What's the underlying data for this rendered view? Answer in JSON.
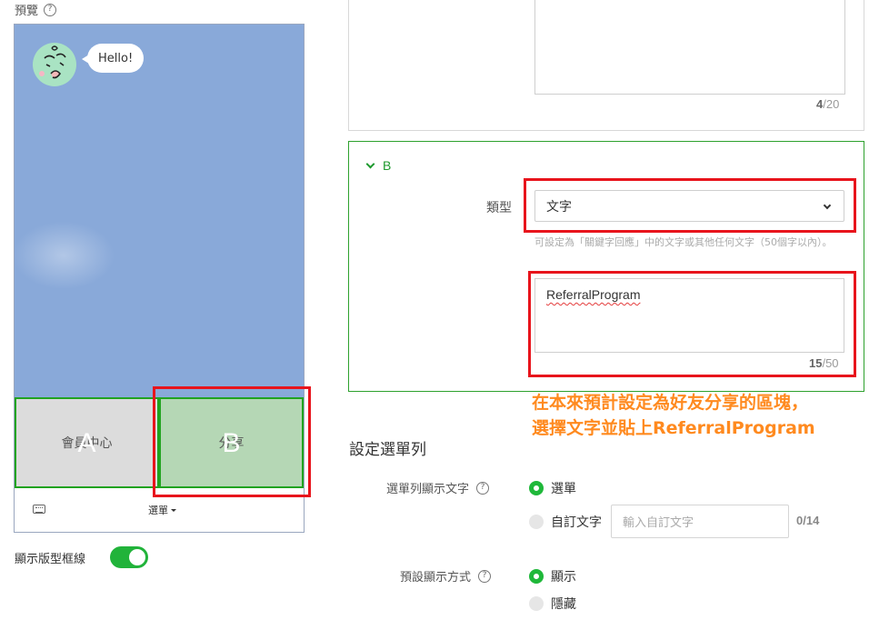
{
  "preview": {
    "label": "預覽",
    "help": "?",
    "chat": {
      "message": "Hello!"
    },
    "areas": [
      {
        "text": "會員中心",
        "letter": "A"
      },
      {
        "text": "分享",
        "letter": "B"
      }
    ],
    "menu_bar_label": "選單",
    "show_border_label": "顯示版型框線",
    "show_border": true
  },
  "top_section": {
    "counter_current": "4",
    "counter_max": "/20"
  },
  "section_b": {
    "title": "B",
    "type_label": "類型",
    "type_value": "文字",
    "hint": "可設定為「關鍵字回應」中的文字或其他任何文字（50個字以內）。",
    "text_value": "ReferralProgram",
    "counter_current": "15",
    "counter_max": "/50"
  },
  "annotation": {
    "line1": "在本來預計設定為好友分享的區塊，",
    "line2": "選擇文字並貼上ReferralProgram"
  },
  "menu_settings": {
    "title": "設定選單列",
    "display_text_label": "選單列顯示文字",
    "option_menu": "選單",
    "option_custom": "自訂文字",
    "custom_placeholder": "輸入自訂文字",
    "custom_counter": "0/14",
    "default_display_label": "預設顯示方式",
    "option_show": "顯示",
    "option_hide": "隱藏"
  },
  "colors": {
    "accent_green": "#1fb83a",
    "annotation_red": "#e8141c",
    "annotation_orange": "#ff8a1f"
  }
}
